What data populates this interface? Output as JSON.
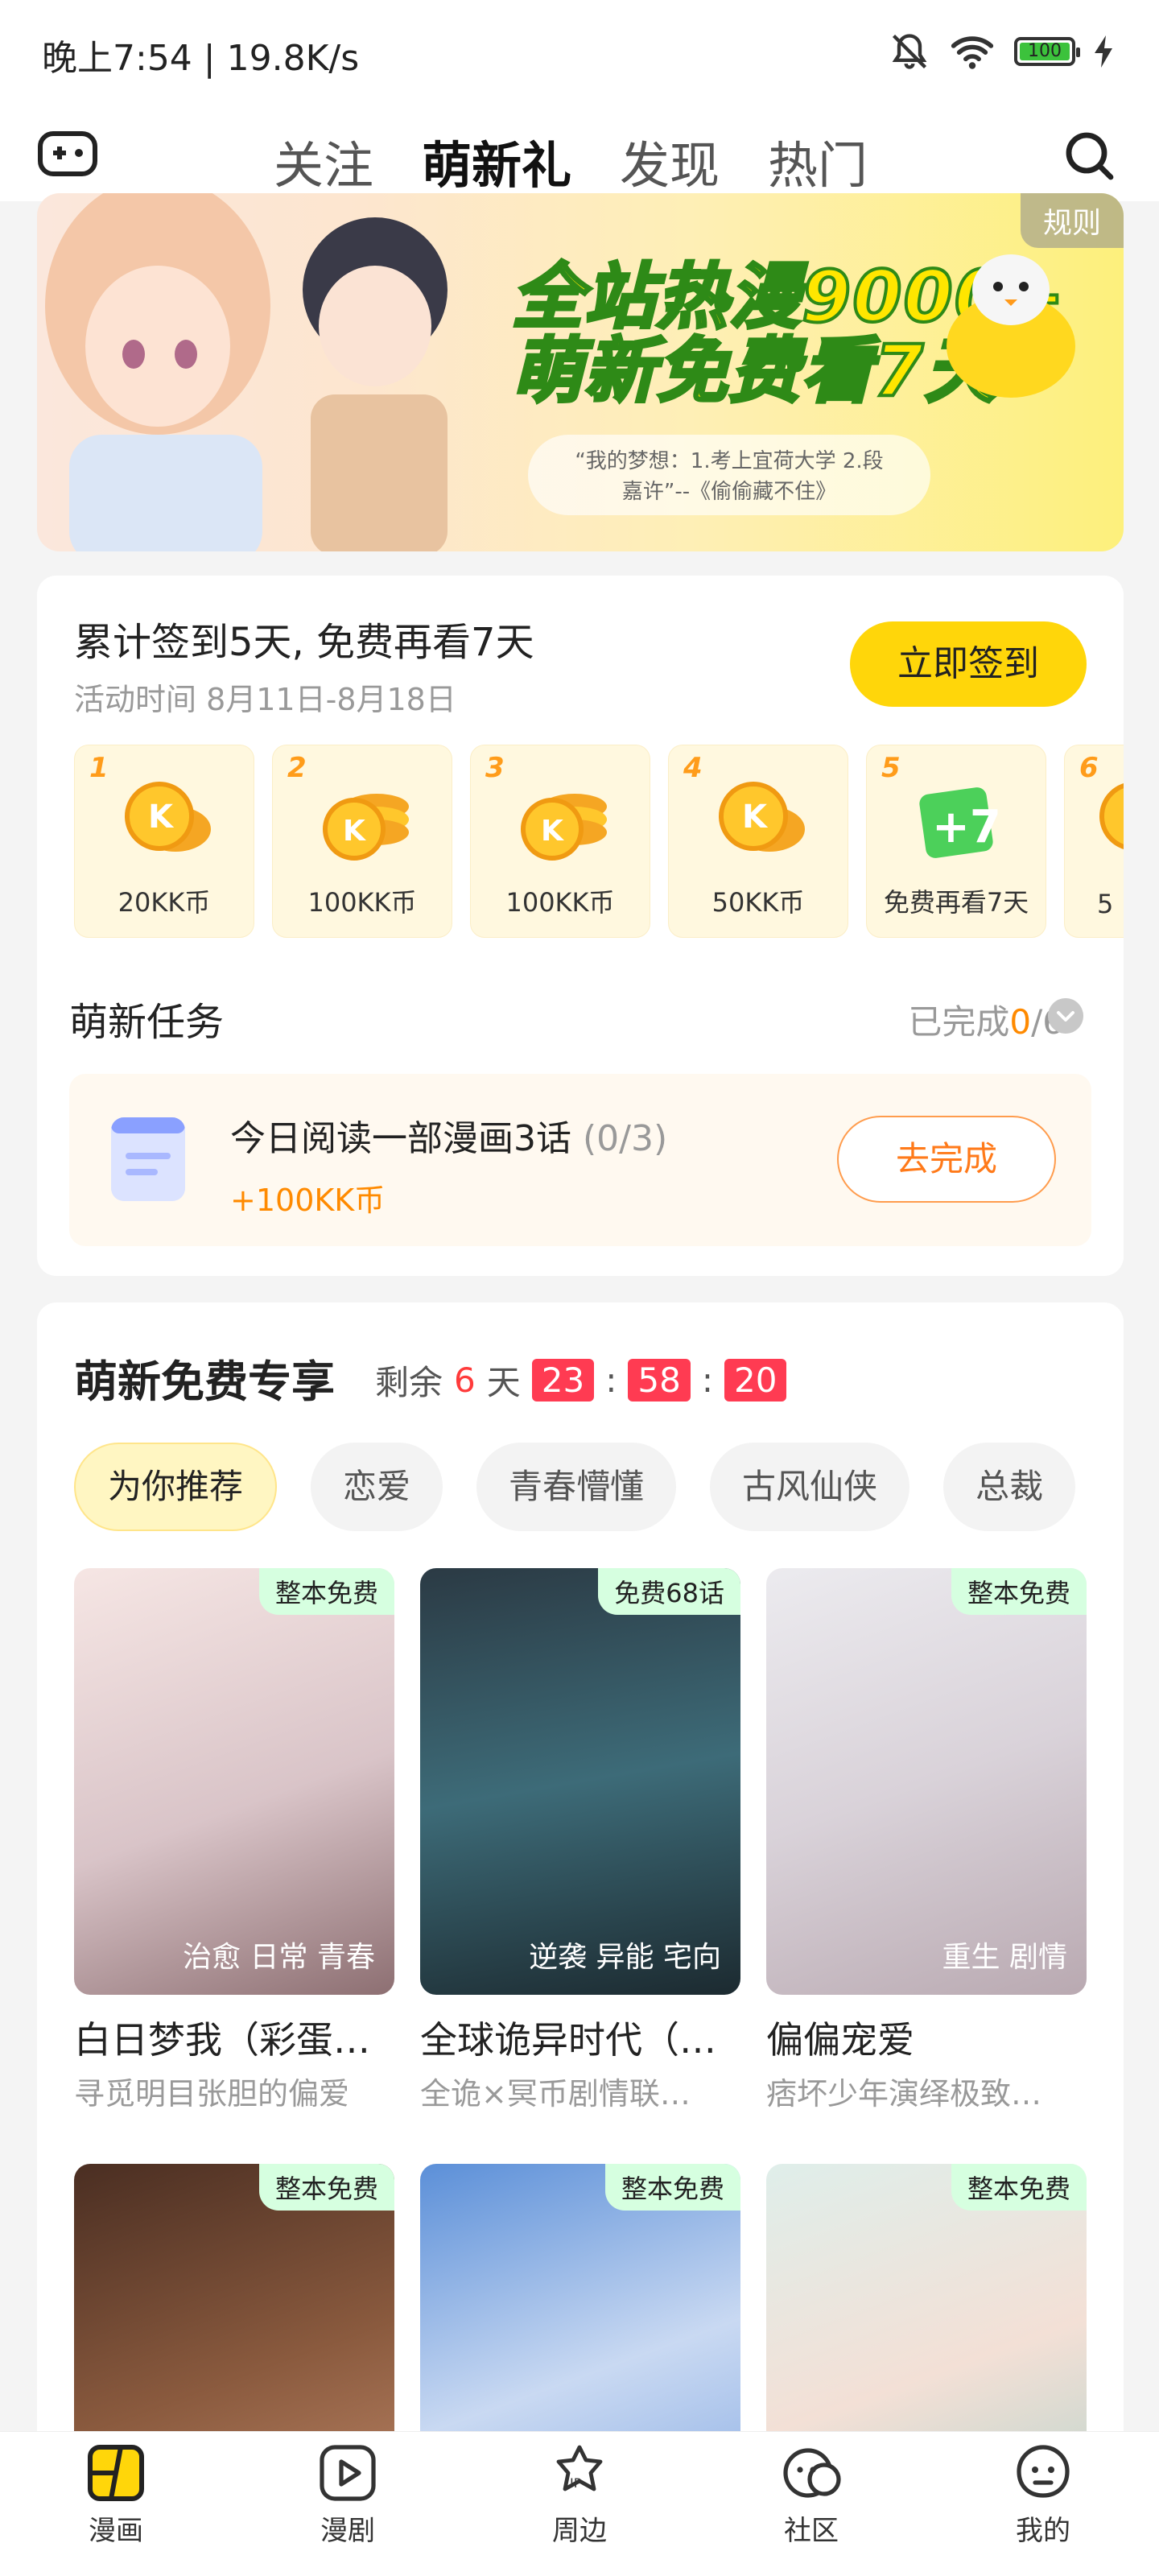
{
  "status": {
    "time": "晚上7:54 | 19.8K/s",
    "battery": "100"
  },
  "tabs": [
    "关注",
    "萌新礼",
    "发现",
    "热门"
  ],
  "banner": {
    "rule": "规则",
    "title1": "全站热漫9000+",
    "title2": "萌新免费看7天",
    "quote_line1": "“我的梦想：1.考上宜荷大学 2.段",
    "quote_line2": "嘉许”--《偷偷藏不住》"
  },
  "checkin": {
    "title": "累计签到5天, 免费再看7天",
    "period": "活动时间 8月11日-8月18日",
    "button": "立即签到",
    "days": [
      {
        "num": "1",
        "label": "20KK币"
      },
      {
        "num": "2",
        "label": "100KK币"
      },
      {
        "num": "3",
        "label": "100KK币"
      },
      {
        "num": "4",
        "label": "50KK币"
      },
      {
        "num": "5",
        "label": "免费再看7天"
      },
      {
        "num": "6",
        "label": "5"
      }
    ]
  },
  "tasks": {
    "title": "萌新任务",
    "progress_prefix": "已完成",
    "progress_done": "0",
    "progress_total": "/6",
    "task_text": "今日阅读一部漫画3话",
    "task_count": "(0/3)",
    "task_reward": "+100KK币",
    "task_button": "去完成"
  },
  "free": {
    "title": "萌新免费专享",
    "remaining_label": "剩余",
    "remaining_days": "6",
    "days_unit": "天",
    "hh": "23",
    "mm": "58",
    "ss": "20",
    "categories": [
      "为你推荐",
      "恋爱",
      "青春懵懂",
      "古风仙侠",
      "总裁"
    ],
    "comics": [
      {
        "badge": "整本免费",
        "tags": "治愈 日常 青春",
        "title": "白日梦我（彩蛋…",
        "desc": "寻觅明目张胆的偏爱"
      },
      {
        "badge": "免费68话",
        "tags": "逆袭 异能 宅向",
        "title": "全球诡异时代（…",
        "desc": "全诡×冥币剧情联…"
      },
      {
        "badge": "整本免费",
        "tags": "重生 剧情",
        "title": "偏偏宠爱",
        "desc": "痞坏少年演绎极致…"
      },
      {
        "badge": "整本免费",
        "tags": "",
        "title": "",
        "desc": ""
      },
      {
        "badge": "整本免费",
        "tags": "",
        "title": "",
        "desc": ""
      },
      {
        "badge": "整本免费",
        "tags": "",
        "title": "",
        "desc": ""
      }
    ]
  },
  "bottom_nav": [
    "漫画",
    "漫剧",
    "周边",
    "社区",
    "我的"
  ],
  "colors": {
    "accent": "#ffd60a",
    "orange": "#ff8a00",
    "red": "#ff3b52"
  }
}
